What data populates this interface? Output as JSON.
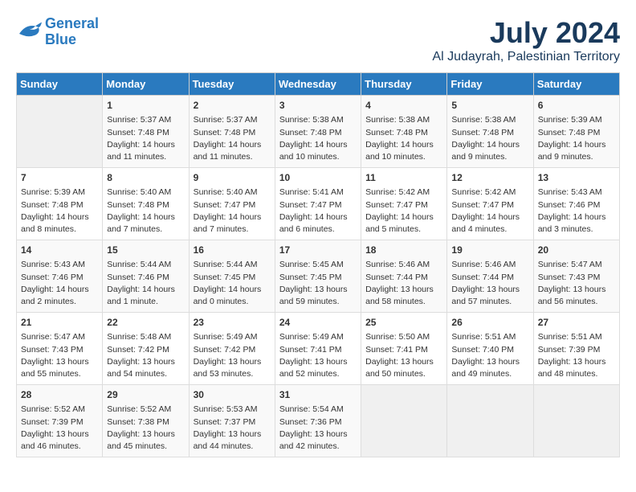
{
  "logo": {
    "line1": "General",
    "line2": "Blue"
  },
  "title": "July 2024",
  "location": "Al Judayrah, Palestinian Territory",
  "days_of_week": [
    "Sunday",
    "Monday",
    "Tuesday",
    "Wednesday",
    "Thursday",
    "Friday",
    "Saturday"
  ],
  "weeks": [
    [
      {
        "day": "",
        "info": ""
      },
      {
        "day": "1",
        "info": "Sunrise: 5:37 AM\nSunset: 7:48 PM\nDaylight: 14 hours\nand 11 minutes."
      },
      {
        "day": "2",
        "info": "Sunrise: 5:37 AM\nSunset: 7:48 PM\nDaylight: 14 hours\nand 11 minutes."
      },
      {
        "day": "3",
        "info": "Sunrise: 5:38 AM\nSunset: 7:48 PM\nDaylight: 14 hours\nand 10 minutes."
      },
      {
        "day": "4",
        "info": "Sunrise: 5:38 AM\nSunset: 7:48 PM\nDaylight: 14 hours\nand 10 minutes."
      },
      {
        "day": "5",
        "info": "Sunrise: 5:38 AM\nSunset: 7:48 PM\nDaylight: 14 hours\nand 9 minutes."
      },
      {
        "day": "6",
        "info": "Sunrise: 5:39 AM\nSunset: 7:48 PM\nDaylight: 14 hours\nand 9 minutes."
      }
    ],
    [
      {
        "day": "7",
        "info": "Sunrise: 5:39 AM\nSunset: 7:48 PM\nDaylight: 14 hours\nand 8 minutes."
      },
      {
        "day": "8",
        "info": "Sunrise: 5:40 AM\nSunset: 7:48 PM\nDaylight: 14 hours\nand 7 minutes."
      },
      {
        "day": "9",
        "info": "Sunrise: 5:40 AM\nSunset: 7:47 PM\nDaylight: 14 hours\nand 7 minutes."
      },
      {
        "day": "10",
        "info": "Sunrise: 5:41 AM\nSunset: 7:47 PM\nDaylight: 14 hours\nand 6 minutes."
      },
      {
        "day": "11",
        "info": "Sunrise: 5:42 AM\nSunset: 7:47 PM\nDaylight: 14 hours\nand 5 minutes."
      },
      {
        "day": "12",
        "info": "Sunrise: 5:42 AM\nSunset: 7:47 PM\nDaylight: 14 hours\nand 4 minutes."
      },
      {
        "day": "13",
        "info": "Sunrise: 5:43 AM\nSunset: 7:46 PM\nDaylight: 14 hours\nand 3 minutes."
      }
    ],
    [
      {
        "day": "14",
        "info": "Sunrise: 5:43 AM\nSunset: 7:46 PM\nDaylight: 14 hours\nand 2 minutes."
      },
      {
        "day": "15",
        "info": "Sunrise: 5:44 AM\nSunset: 7:46 PM\nDaylight: 14 hours\nand 1 minute."
      },
      {
        "day": "16",
        "info": "Sunrise: 5:44 AM\nSunset: 7:45 PM\nDaylight: 14 hours\nand 0 minutes."
      },
      {
        "day": "17",
        "info": "Sunrise: 5:45 AM\nSunset: 7:45 PM\nDaylight: 13 hours\nand 59 minutes."
      },
      {
        "day": "18",
        "info": "Sunrise: 5:46 AM\nSunset: 7:44 PM\nDaylight: 13 hours\nand 58 minutes."
      },
      {
        "day": "19",
        "info": "Sunrise: 5:46 AM\nSunset: 7:44 PM\nDaylight: 13 hours\nand 57 minutes."
      },
      {
        "day": "20",
        "info": "Sunrise: 5:47 AM\nSunset: 7:43 PM\nDaylight: 13 hours\nand 56 minutes."
      }
    ],
    [
      {
        "day": "21",
        "info": "Sunrise: 5:47 AM\nSunset: 7:43 PM\nDaylight: 13 hours\nand 55 minutes."
      },
      {
        "day": "22",
        "info": "Sunrise: 5:48 AM\nSunset: 7:42 PM\nDaylight: 13 hours\nand 54 minutes."
      },
      {
        "day": "23",
        "info": "Sunrise: 5:49 AM\nSunset: 7:42 PM\nDaylight: 13 hours\nand 53 minutes."
      },
      {
        "day": "24",
        "info": "Sunrise: 5:49 AM\nSunset: 7:41 PM\nDaylight: 13 hours\nand 52 minutes."
      },
      {
        "day": "25",
        "info": "Sunrise: 5:50 AM\nSunset: 7:41 PM\nDaylight: 13 hours\nand 50 minutes."
      },
      {
        "day": "26",
        "info": "Sunrise: 5:51 AM\nSunset: 7:40 PM\nDaylight: 13 hours\nand 49 minutes."
      },
      {
        "day": "27",
        "info": "Sunrise: 5:51 AM\nSunset: 7:39 PM\nDaylight: 13 hours\nand 48 minutes."
      }
    ],
    [
      {
        "day": "28",
        "info": "Sunrise: 5:52 AM\nSunset: 7:39 PM\nDaylight: 13 hours\nand 46 minutes."
      },
      {
        "day": "29",
        "info": "Sunrise: 5:52 AM\nSunset: 7:38 PM\nDaylight: 13 hours\nand 45 minutes."
      },
      {
        "day": "30",
        "info": "Sunrise: 5:53 AM\nSunset: 7:37 PM\nDaylight: 13 hours\nand 44 minutes."
      },
      {
        "day": "31",
        "info": "Sunrise: 5:54 AM\nSunset: 7:36 PM\nDaylight: 13 hours\nand 42 minutes."
      },
      {
        "day": "",
        "info": ""
      },
      {
        "day": "",
        "info": ""
      },
      {
        "day": "",
        "info": ""
      }
    ]
  ]
}
